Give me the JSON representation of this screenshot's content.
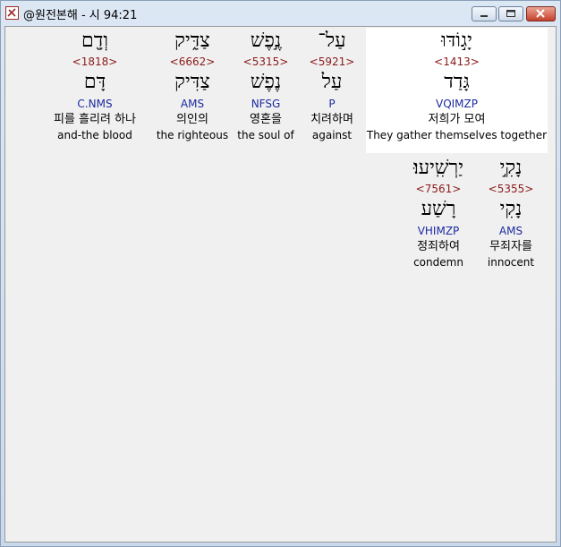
{
  "window": {
    "title": "@원전본해 - 시 94:21"
  },
  "rows": [
    [
      {
        "hebrew": "יָג֣וֹדּוּ",
        "strong": "<1413>",
        "lemma": "גָּדַד",
        "parse": "VQIMZP",
        "korean": "저희가 모여",
        "english": "They gather themselves together",
        "highlight": true
      },
      {
        "hebrew": "עַל־",
        "strong": "<5921>",
        "lemma": "עַל",
        "parse": "P",
        "korean": "치려하며",
        "english": "against",
        "highlight": false
      },
      {
        "hebrew": "נֶ֣פֶשׁ",
        "strong": "<5315>",
        "lemma": "נֶפֶשׁ",
        "parse": "NFSG",
        "korean": "영혼을",
        "english": "the soul of",
        "highlight": false
      },
      {
        "hebrew": "צַדִּ֑יק",
        "strong": "<6662>",
        "lemma": "צַדִּיק",
        "parse": "AMS",
        "korean": "의인의",
        "english": "the righteous",
        "highlight": false
      },
      {
        "hebrew": "וְדָ֖ם",
        "strong": "<1818>",
        "lemma": "דָּם",
        "parse": "C.NMS",
        "korean": "피를 흘리려 하나",
        "english": "and-the blood",
        "highlight": false
      }
    ],
    [
      {
        "hebrew": "נָקִ֣י",
        "strong": "<5355>",
        "lemma": "נָקִי",
        "parse": "AMS",
        "korean": "무죄자를",
        "english": "innocent",
        "highlight": false
      },
      {
        "hebrew": "יַרְשִֽׁיעוּ׃",
        "strong": "<7561>",
        "lemma": "רָשַׁע",
        "parse": "VHIMZP",
        "korean": "정죄하여",
        "english": "condemn",
        "highlight": false
      }
    ]
  ]
}
